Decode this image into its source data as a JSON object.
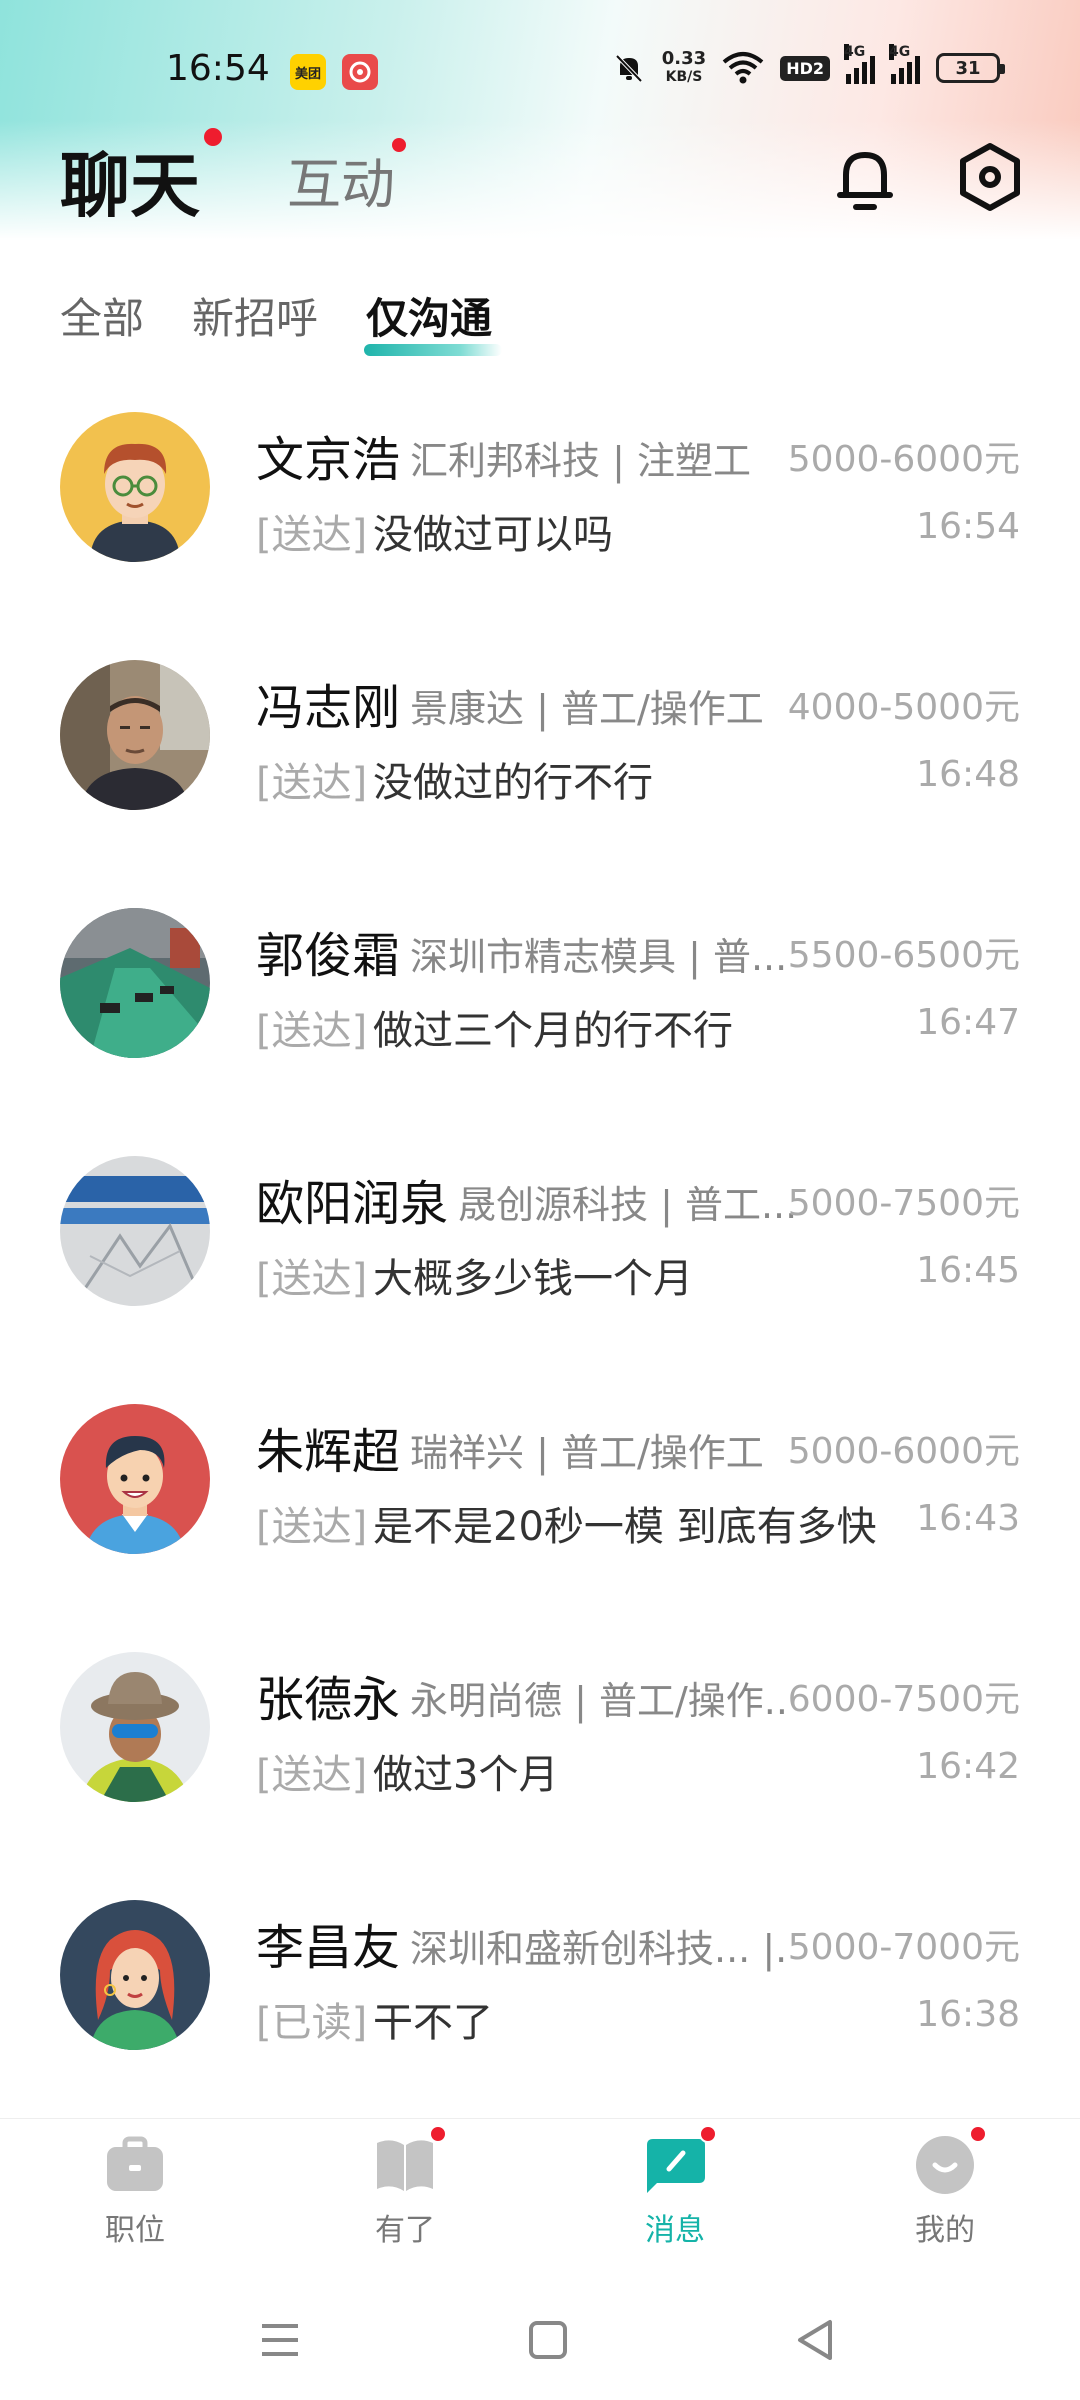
{
  "status_bar": {
    "time": "16:54",
    "app_icons": [
      {
        "name": "meituan-icon",
        "label": "美团",
        "color": "#ffd100"
      },
      {
        "name": "red-app-icon",
        "label": "",
        "color": "#e94a4a"
      }
    ],
    "net_speed_value": "0.33",
    "net_speed_unit": "KB/S",
    "hd_label": "HD2",
    "signal_label_1": "4G",
    "signal_label_2": "4G",
    "battery": "31"
  },
  "header": {
    "title": "聊天",
    "secondary_title": "互动",
    "accent": "#ee1d2e"
  },
  "filter_tabs": [
    {
      "label": "全部",
      "active": false
    },
    {
      "label": "新招呼",
      "active": false
    },
    {
      "label": "仅沟通",
      "active": true
    }
  ],
  "chats": [
    {
      "name": "文京浩",
      "company": "汇利邦科技 | 注塑工",
      "salary": "5000-6000元",
      "status": "[送达]",
      "message": "没做过可以吗",
      "time": "16:54"
    },
    {
      "name": "冯志刚",
      "company": "景康达 | 普工/操作工",
      "salary": "4000-5000元",
      "status": "[送达]",
      "message": "没做过的行不行",
      "time": "16:48"
    },
    {
      "name": "郭俊霜",
      "company": "深圳市精志模具 | 普...",
      "salary": "5500-6500元",
      "status": "[送达]",
      "message": "做过三个月的行不行",
      "time": "16:47"
    },
    {
      "name": "欧阳润泉",
      "company": "晟创源科技 | 普工...",
      "salary": "5000-7500元",
      "status": "[送达]",
      "message": "大概多少钱一个月",
      "time": "16:45"
    },
    {
      "name": "朱辉超",
      "company": "瑞祥兴 | 普工/操作工",
      "salary": "5000-6000元",
      "status": "[送达]",
      "message": "是不是20秒一模 到底有多快",
      "time": "16:43"
    },
    {
      "name": "张德永",
      "company": "永明尚德 | 普工/操作...",
      "salary": "6000-7500元",
      "status": "[送达]",
      "message": "做过3个月",
      "time": "16:42"
    },
    {
      "name": "李昌友",
      "company": "深圳和盛新创科技... |...",
      "salary": "5000-7000元",
      "status": "[已读]",
      "message": "干不了",
      "time": "16:38"
    }
  ],
  "bottom_nav": [
    {
      "label": "职位",
      "icon": "briefcase-icon",
      "active": false,
      "dot": false
    },
    {
      "label": "有了",
      "icon": "book-icon",
      "active": false,
      "dot": true
    },
    {
      "label": "消息",
      "icon": "message-icon",
      "active": true,
      "dot": true
    },
    {
      "label": "我的",
      "icon": "profile-icon",
      "active": false,
      "dot": true
    }
  ],
  "colors": {
    "brand": "#15b3a8",
    "inactive_icon": "#c4c4c4"
  }
}
